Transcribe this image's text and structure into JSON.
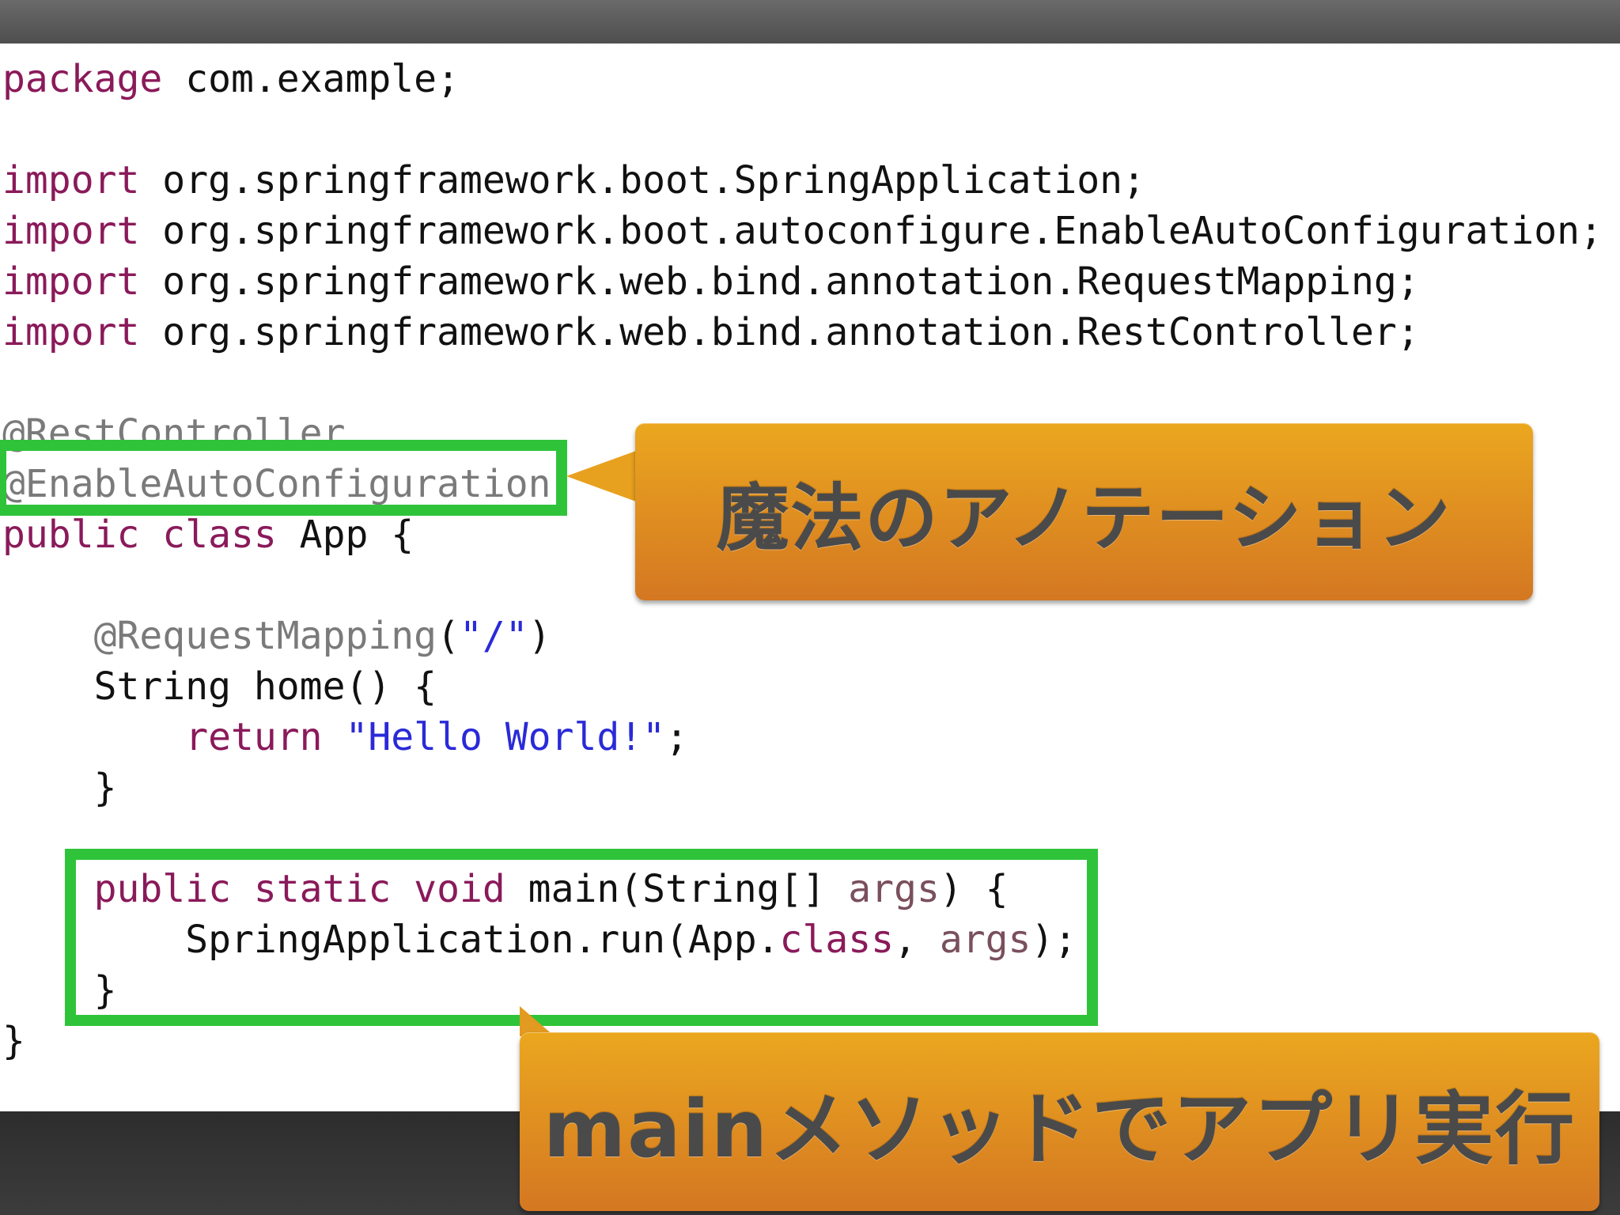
{
  "code": {
    "lines": [
      [
        {
          "t": "package",
          "c": "kw"
        },
        {
          "t": " com.example;",
          "c": ""
        }
      ],
      [],
      [
        {
          "t": "import",
          "c": "kw"
        },
        {
          "t": " org.springframework.boot.SpringApplication;",
          "c": ""
        }
      ],
      [
        {
          "t": "import",
          "c": "kw"
        },
        {
          "t": " org.springframework.boot.autoconfigure.EnableAutoConfiguration;",
          "c": ""
        }
      ],
      [
        {
          "t": "import",
          "c": "kw"
        },
        {
          "t": " org.springframework.web.bind.annotation.RequestMapping;",
          "c": ""
        }
      ],
      [
        {
          "t": "import",
          "c": "kw"
        },
        {
          "t": " org.springframework.web.bind.annotation.RestController;",
          "c": ""
        }
      ],
      [],
      [
        {
          "t": "@RestController",
          "c": "ann"
        }
      ],
      [
        {
          "t": "@EnableAutoConfiguration",
          "c": "ann"
        }
      ],
      [
        {
          "t": "public class",
          "c": "kw"
        },
        {
          "t": " App {",
          "c": ""
        }
      ],
      [],
      [
        {
          "t": "    @RequestMapping",
          "c": "ann"
        },
        {
          "t": "(",
          "c": ""
        },
        {
          "t": "\"/\"",
          "c": "str"
        },
        {
          "t": ")",
          "c": ""
        }
      ],
      [
        {
          "t": "    String home() {",
          "c": ""
        }
      ],
      [
        {
          "t": "        return",
          "c": "kw"
        },
        {
          "t": " ",
          "c": ""
        },
        {
          "t": "\"Hello World!\"",
          "c": "str"
        },
        {
          "t": ";",
          "c": ""
        }
      ],
      [
        {
          "t": "    }",
          "c": ""
        }
      ],
      [],
      [
        {
          "t": "    public static void",
          "c": "kw"
        },
        {
          "t": " main(String[] ",
          "c": ""
        },
        {
          "t": "args",
          "c": "arg"
        },
        {
          "t": ") {",
          "c": ""
        }
      ],
      [
        {
          "t": "        SpringApplication.run(App.",
          "c": ""
        },
        {
          "t": "class",
          "c": "kw"
        },
        {
          "t": ", ",
          "c": ""
        },
        {
          "t": "args",
          "c": "arg"
        },
        {
          "t": ");",
          "c": ""
        }
      ],
      [
        {
          "t": "    }",
          "c": ""
        }
      ],
      [
        {
          "t": "}",
          "c": ""
        }
      ]
    ]
  },
  "callouts": {
    "annotation_label": "魔法のアノテーション",
    "main_label": "mainメソッドでアプリ実行"
  },
  "colors": {
    "keyword": "#8a1a5a",
    "annotation": "#7a7a7a",
    "string": "#2a2ad8",
    "highlight_border": "#2fc33a",
    "callout_orange": "#e29a20"
  }
}
